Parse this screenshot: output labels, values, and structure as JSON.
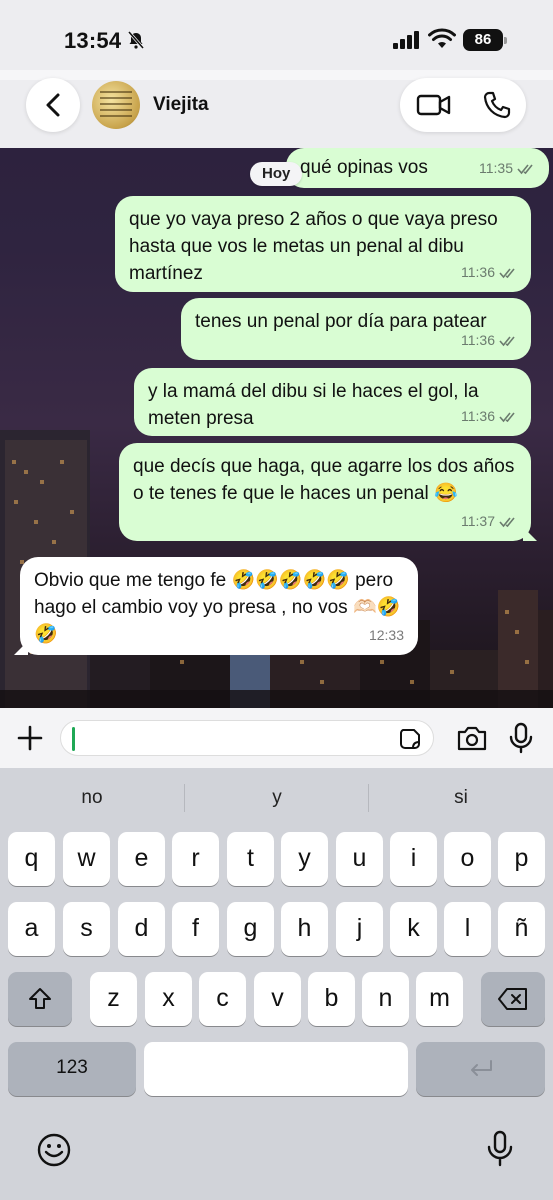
{
  "status": {
    "time": "13:54",
    "battery": "86"
  },
  "header": {
    "contact_name": "Viejita",
    "icons": [
      "chevron-left-icon",
      "video-call-icon",
      "phone-icon"
    ]
  },
  "chat": {
    "day_chip": "Hoy",
    "messages": [
      {
        "dir": "out",
        "text": "qué opinas vos",
        "time": "11:35"
      },
      {
        "dir": "out",
        "text": "que yo vaya preso 2 años o que vaya preso hasta que vos le metas un penal al dibu martínez",
        "time": "11:36"
      },
      {
        "dir": "out",
        "text": "tenes un penal por día para patear",
        "time": "11:36"
      },
      {
        "dir": "out",
        "text": "y la mamá del dibu si le haces el gol, la meten presa",
        "time": "11:36"
      },
      {
        "dir": "out",
        "text": "que decís que haga, que agarre los dos años o te tenes fe que le haces un penal 😂",
        "time": "11:37"
      },
      {
        "dir": "in",
        "text": "Obvio que me tengo fe 🤣🤣🤣🤣🤣 pero hago el cambio voy yo presa , no vos 🫶🏻🤣🤣",
        "time": "12:33"
      }
    ]
  },
  "composer": {
    "value": "",
    "icons": [
      "plus-icon",
      "sticker-icon",
      "camera-icon",
      "microphone-icon"
    ]
  },
  "keyboard": {
    "suggestions": [
      "no",
      "y",
      "si"
    ],
    "row1": [
      "q",
      "w",
      "e",
      "r",
      "t",
      "y",
      "u",
      "i",
      "o",
      "p"
    ],
    "row2": [
      "a",
      "s",
      "d",
      "f",
      "g",
      "h",
      "j",
      "k",
      "l",
      "ñ"
    ],
    "row3": [
      "z",
      "x",
      "c",
      "v",
      "b",
      "n",
      "m"
    ],
    "numbers_key": "123",
    "icons": [
      "shift-icon",
      "backspace-icon",
      "return-icon",
      "emoji-icon",
      "dictation-mic-icon"
    ]
  }
}
